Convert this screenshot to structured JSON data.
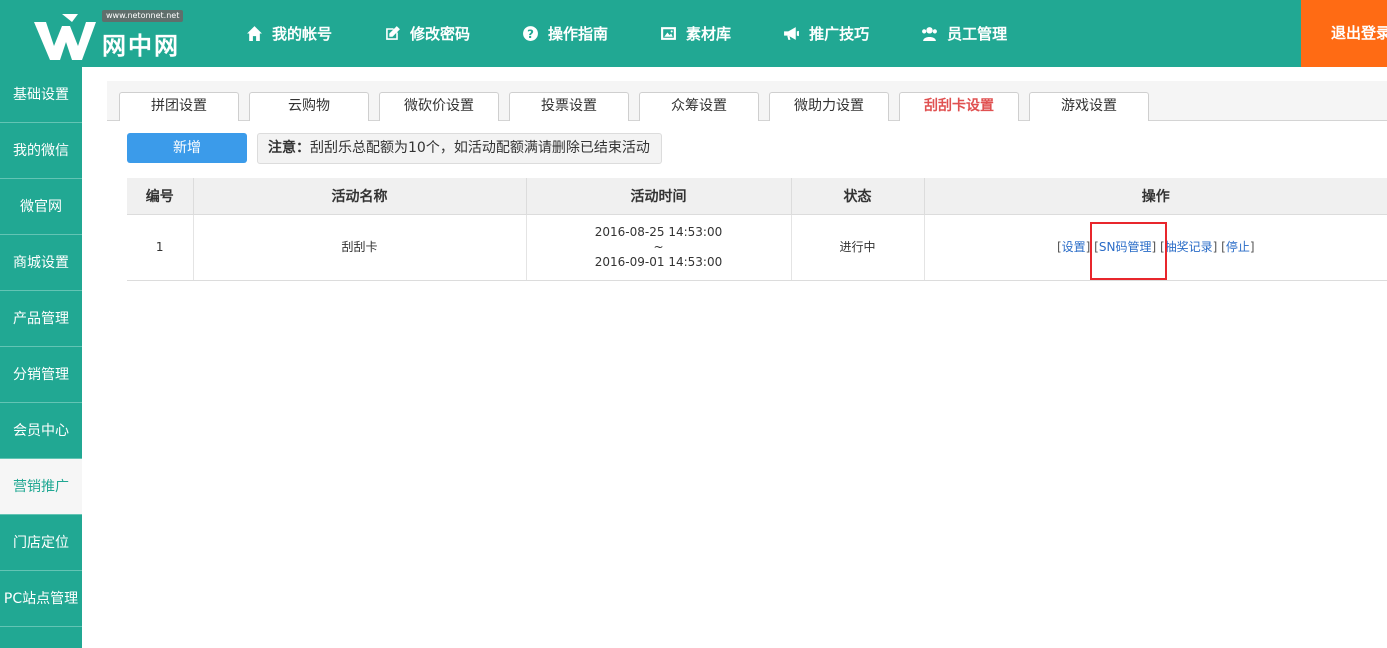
{
  "logo": {
    "domain": "www.netonnet.net",
    "name": "网中网"
  },
  "nav": [
    {
      "label": "我的帐号",
      "icon": "home-icon"
    },
    {
      "label": "修改密码",
      "icon": "edit-icon"
    },
    {
      "label": "操作指南",
      "icon": "help-icon"
    },
    {
      "label": "素材库",
      "icon": "image-icon"
    },
    {
      "label": "推广技巧",
      "icon": "megaphone-icon"
    },
    {
      "label": "员工管理",
      "icon": "users-icon"
    }
  ],
  "logout": {
    "label": "退出登录",
    "icon": "power-icon"
  },
  "sidebar": {
    "items": [
      {
        "label": "基础设置"
      },
      {
        "label": "我的微信"
      },
      {
        "label": "微官网"
      },
      {
        "label": "商城设置"
      },
      {
        "label": "产品管理"
      },
      {
        "label": "分销管理"
      },
      {
        "label": "会员中心"
      },
      {
        "label": "营销推广",
        "active": true
      },
      {
        "label": "门店定位"
      },
      {
        "label": "PC站点管理"
      }
    ]
  },
  "tabs": [
    {
      "label": "拼团设置"
    },
    {
      "label": "云购物"
    },
    {
      "label": "微砍价设置"
    },
    {
      "label": "投票设置"
    },
    {
      "label": "众筹设置"
    },
    {
      "label": "微助力设置"
    },
    {
      "label": "刮刮卡设置",
      "active": true
    },
    {
      "label": "游戏设置"
    }
  ],
  "actions": {
    "new_label": "新增",
    "notice_prefix": "注意：",
    "notice_text": "刮刮乐总配额为10个，如活动配额满请删除已结束活动"
  },
  "table": {
    "headers": [
      "编号",
      "活动名称",
      "活动时间",
      "状态",
      "操作"
    ],
    "rows": [
      {
        "id": "1",
        "name": "刮刮卡",
        "start": "2016-08-25 14:53:00",
        "sep": "~",
        "end": "2016-09-01 14:53:00",
        "status": "进行中",
        "ops": [
          "设置",
          "SN码管理",
          "抽奖记录",
          "停止"
        ]
      }
    ]
  },
  "colors": {
    "primary": "#21a893",
    "logout": "#ff6b14",
    "button": "#3b9bea",
    "active_tab": "#e05151",
    "highlight": "#e8262c"
  }
}
